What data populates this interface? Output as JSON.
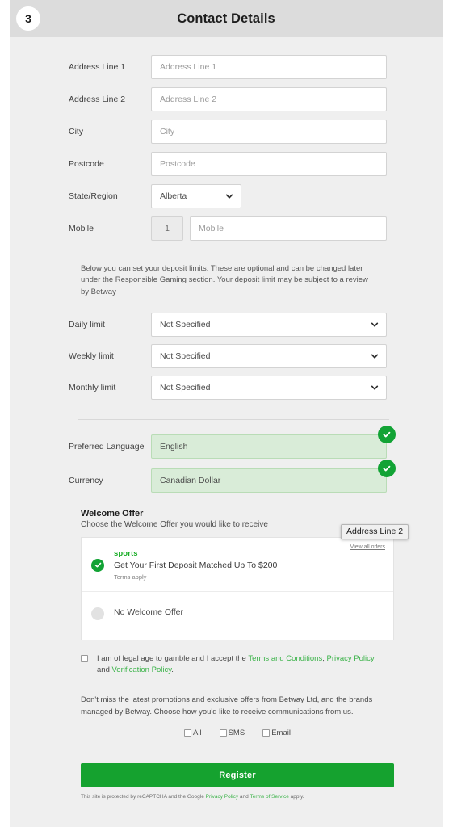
{
  "header": {
    "step": "3",
    "title": "Contact Details"
  },
  "address": {
    "line1": {
      "label": "Address Line 1",
      "placeholder": "Address Line 1",
      "value": ""
    },
    "line2": {
      "label": "Address Line 2",
      "placeholder": "Address Line 2",
      "value": ""
    },
    "city": {
      "label": "City",
      "placeholder": "City",
      "value": ""
    },
    "postcode": {
      "label": "Postcode",
      "placeholder": "Postcode",
      "value": ""
    },
    "state": {
      "label": "State/Region",
      "value": "Alberta"
    },
    "mobile": {
      "label": "Mobile",
      "prefix": "1",
      "placeholder": "Mobile",
      "value": ""
    }
  },
  "deposit_limits": {
    "blurb": "Below you can set your deposit limits. These are optional and can be changed later under the Responsible Gaming section. Your deposit limit may be subject to a review by Betway",
    "daily": {
      "label": "Daily limit",
      "value": "Not Specified"
    },
    "weekly": {
      "label": "Weekly limit",
      "value": "Not Specified"
    },
    "monthly": {
      "label": "Monthly limit",
      "value": "Not Specified"
    }
  },
  "preferences": {
    "language": {
      "label": "Preferred Language",
      "value": "English"
    },
    "currency": {
      "label": "Currency",
      "value": "Canadian Dollar"
    }
  },
  "welcome_offer": {
    "heading": "Welcome Offer",
    "subheading": "Choose the Welcome Offer you would like to receive",
    "view_all": "View all offers",
    "options": [
      {
        "brand": "sports",
        "title": "Get Your First Deposit Matched Up To $200",
        "terms": "Terms apply",
        "selected": true
      },
      {
        "title": "No Welcome Offer",
        "selected": false
      }
    ]
  },
  "tooltip": {
    "text": "Address Line 2"
  },
  "consent": {
    "text_1": "I am of legal age to gamble and I accept the ",
    "link_terms": "Terms and Conditions",
    "sep_1": ", ",
    "link_privacy": "Privacy Policy",
    "sep_2": " and ",
    "link_verification": "Verification Policy",
    "text_end": "."
  },
  "marketing": {
    "text": "Don't miss the latest promotions and exclusive offers from Betway Ltd, and the brands managed by Betway. Choose how you'd like to receive communications from us.",
    "options": [
      "All",
      "SMS",
      "Email"
    ]
  },
  "submit": {
    "label": "Register"
  },
  "recaptcha": {
    "text_1": "This site is protected by reCAPTCHA and the Google ",
    "link_privacy": "Privacy Policy",
    "sep": " and ",
    "link_tos": "Terms of Service",
    "text_end": " apply."
  },
  "colors": {
    "accent_green": "#15a22f",
    "link_green": "#3cb34a",
    "valid_field_bg": "#d9ecd8",
    "panel_bg": "#efefef",
    "header_bg": "#dcdcdc"
  }
}
